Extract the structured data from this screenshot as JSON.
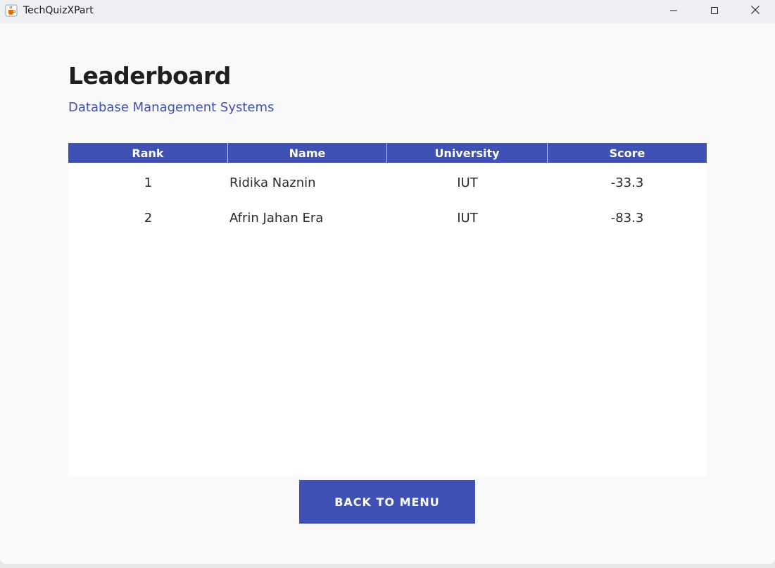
{
  "window": {
    "title": "TechQuizXPart",
    "icon": "java-cup-icon",
    "controls": [
      "minimize-icon",
      "maximize-icon",
      "close-icon"
    ]
  },
  "page": {
    "title": "Leaderboard",
    "subtitle": "Database Management Systems"
  },
  "table": {
    "columns": [
      "Rank",
      "Name",
      "University",
      "Score"
    ],
    "rows": [
      {
        "rank": "1",
        "name": "Ridika Naznin",
        "university": "IUT",
        "score": "-33.3"
      },
      {
        "rank": "2",
        "name": "Afrin Jahan Era",
        "university": "IUT",
        "score": "-83.3"
      }
    ]
  },
  "actions": {
    "back_label": "BACK TO MENU"
  },
  "colors": {
    "accent": "#3f51b5",
    "background": "#f9f9f9",
    "panel": "#ffffff"
  }
}
